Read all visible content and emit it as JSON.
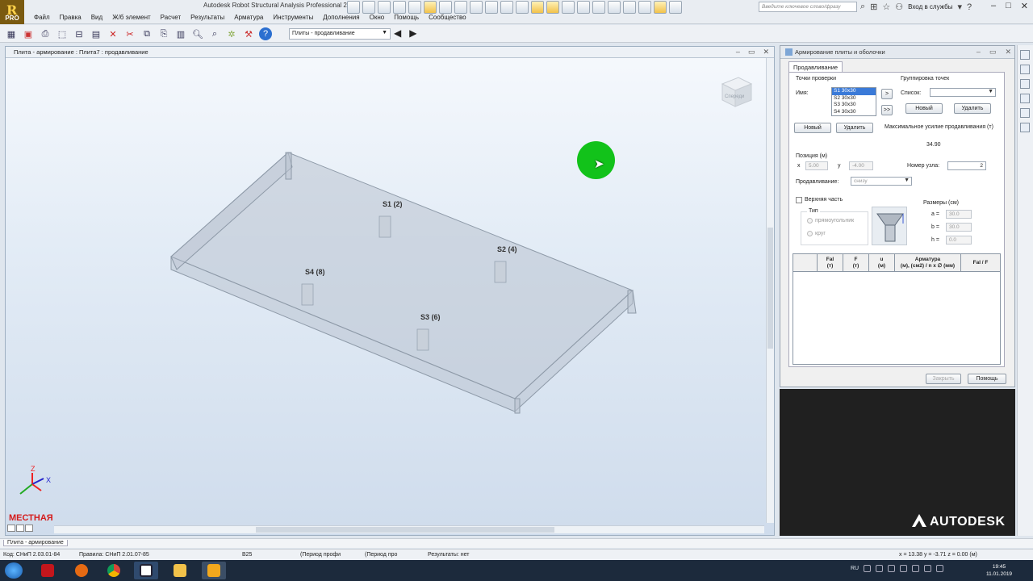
{
  "app": {
    "logo_label": "PRO",
    "window_title": "Autodesk Robot Structural Analysis Professional 2",
    "help_search_placeholder": "Введите ключевое слово/фразу",
    "sign_in_label": "Вход в службы"
  },
  "menu": [
    "Файл",
    "Правка",
    "Вид",
    "Ж/б элемент",
    "Расчет",
    "Результаты",
    "Арматура",
    "Инструменты",
    "Дополнения",
    "Окно",
    "Помощь",
    "Сообщество"
  ],
  "toolbar": {
    "layout_select_value": "Плиты - продавливание"
  },
  "viewport": {
    "title": "Плита - армирование : Плита7 : продавливание",
    "axis_label": "МЕСТНАЯ",
    "cube_label": "Спереди",
    "axis_x": "X",
    "axis_z": "Z",
    "points": [
      {
        "label": "S1 (2)"
      },
      {
        "label": "S2 (4)"
      },
      {
        "label": "S4 (8)"
      },
      {
        "label": "S3 (6)"
      }
    ]
  },
  "dialog": {
    "title": "Армирование плиты и оболочки",
    "tab": "Продавливание",
    "check_points_label": "Точки проверки",
    "name_label": "Имя:",
    "list_items": [
      "S1 30x30",
      "S2 30x30",
      "S3 30x30",
      "S4 30x30"
    ],
    "selected_index": 0,
    "move_one_label": ">",
    "move_all_label": ">>",
    "new_label": "Новый",
    "delete_label": "Удалить",
    "grouping_label": "Группировка точек",
    "list_label": "Список:",
    "group_new_label": "Новый",
    "group_delete_label": "Удалить",
    "max_force_label": "Максимальное усилие продавливания (т)",
    "max_force_value": "34.90",
    "position_label": "Позиция (м)",
    "x_label": "x",
    "x_value": "5.00",
    "y_label": "y",
    "y_value": "-4.00",
    "node_label": "Номер узла:",
    "node_value": "2",
    "punching_label": "Продавливание:",
    "punching_value": "снизу",
    "upper_part_label": "Верхняя часть",
    "type_label": "Тип",
    "rect_label": "прямоугольник",
    "circle_label": "круг",
    "dims_label": "Размеры (см)",
    "a_label": "a =",
    "a_value": "30.0",
    "b_label": "b =",
    "b_value": "30.0",
    "h_label": "h =",
    "h_value": "0.0",
    "table_headers": [
      {
        "top": "",
        "bottom": ""
      },
      {
        "top": "Fal",
        "bottom": "(т)"
      },
      {
        "top": "F",
        "bottom": "(т)"
      },
      {
        "top": "u",
        "bottom": "(м)"
      },
      {
        "top": "Арматура",
        "bottom": "(м), (см2) / n x ∅ (мм)"
      },
      {
        "top": "Fal / F",
        "bottom": ""
      }
    ],
    "close_label": "Закрыть",
    "help_label": "Помощь"
  },
  "brand": "AUTODESK",
  "status": {
    "tab": "Плита - армирование",
    "code": "Код: СНиП 2.03.01-84",
    "rules": "Правила: СНиП 2.01.07-85",
    "concrete": "B25",
    "period1": "(Период профи",
    "period2": "(Период про",
    "results": "Результаты: нет",
    "coords": "x = 13.38  y = -3.71  z = 0.00  (м)"
  },
  "taskbar": {
    "lang": "RU",
    "time": "19:45",
    "date": "11.01.2019"
  }
}
